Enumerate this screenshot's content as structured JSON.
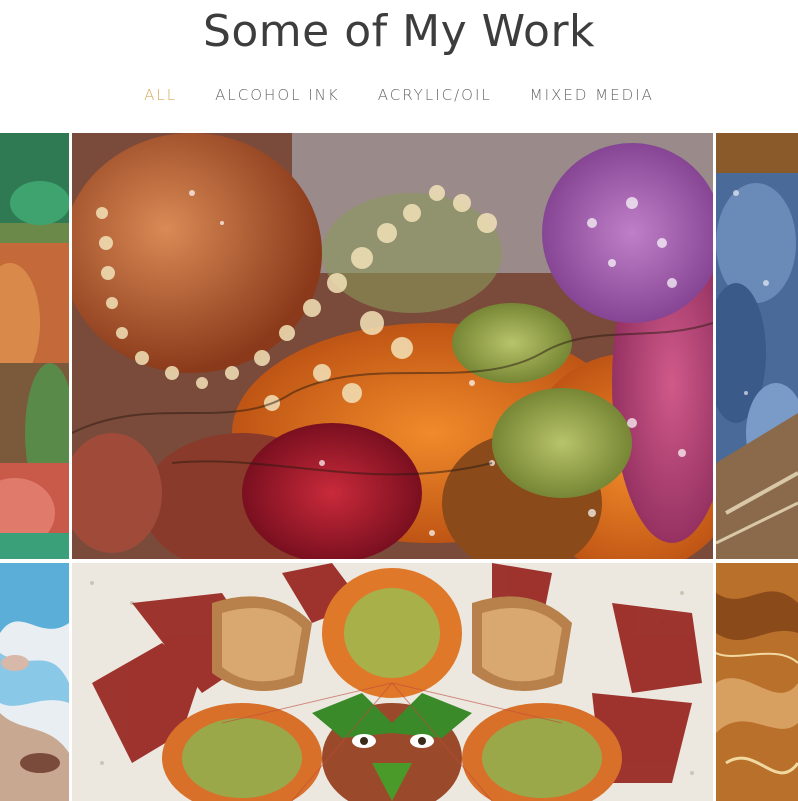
{
  "header": {
    "title": "Some of My Work"
  },
  "filters": [
    {
      "label": "ALL",
      "active": true
    },
    {
      "label": "ALCOHOL INK",
      "active": false
    },
    {
      "label": "ACRYLIC/OIL",
      "active": false
    },
    {
      "label": "MIXED MEDIA",
      "active": false
    }
  ],
  "colors": {
    "active_filter": "#d9a85b",
    "title": "#3d3d3d",
    "filter_text": "#666666"
  },
  "gallery": {
    "items": [
      {
        "name": "artwork-left-top"
      },
      {
        "name": "artwork-harvest-alcohol-ink"
      },
      {
        "name": "artwork-right-top-blue"
      },
      {
        "name": "artwork-left-bottom-blue-pour"
      },
      {
        "name": "artwork-leaf-face-mixed-media"
      },
      {
        "name": "artwork-right-bottom-gold"
      }
    ]
  }
}
